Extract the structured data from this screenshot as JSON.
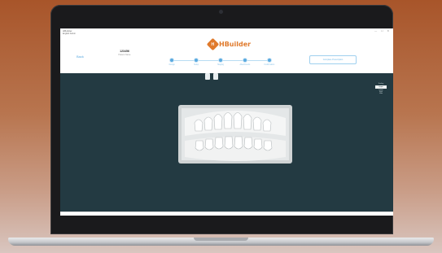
{
  "window": {
    "app_title": "HBuilder",
    "menu": "English Admin",
    "controls": "— ☐ ✕"
  },
  "header": {
    "back_label": "Back",
    "case_id": "123456",
    "case_sub": "Patient Name",
    "logo_text": "HBuilder",
    "action_label": "Complete Prescription"
  },
  "steps": [
    {
      "label": "Design"
    },
    {
      "label": "Setup"
    },
    {
      "label": "Staging"
    },
    {
      "label": "Attachments"
    },
    {
      "label": "Confirmation"
    }
  ],
  "side_panel": {
    "items": [
      "Scaling",
      "Upper",
      "Lower",
      "Both",
      "Hide"
    ]
  },
  "colors": {
    "accent": "#5aa9e0",
    "brand": "#e07a2c",
    "viewport_bg": "#233a42"
  }
}
